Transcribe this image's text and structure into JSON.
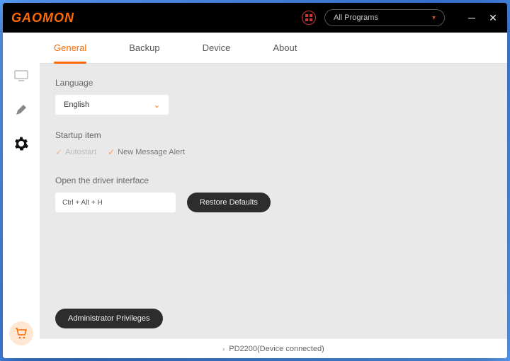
{
  "brand": "GAOMON",
  "titlebar": {
    "program_selector": "All Programs"
  },
  "tabs": [
    {
      "label": "General",
      "active": true
    },
    {
      "label": "Backup",
      "active": false
    },
    {
      "label": "Device",
      "active": false
    },
    {
      "label": "About",
      "active": false
    }
  ],
  "general": {
    "language_label": "Language",
    "language_value": "English",
    "startup_label": "Startup item",
    "autostart_label": "Autostart",
    "new_message_label": "New Message Alert",
    "open_driver_label": "Open the driver interface",
    "hotkey_value": "Ctrl + Alt + H",
    "restore_defaults": "Restore Defaults",
    "admin_privileges": "Administrator Privileges"
  },
  "status": {
    "text": "PD2200(Device connected)"
  }
}
